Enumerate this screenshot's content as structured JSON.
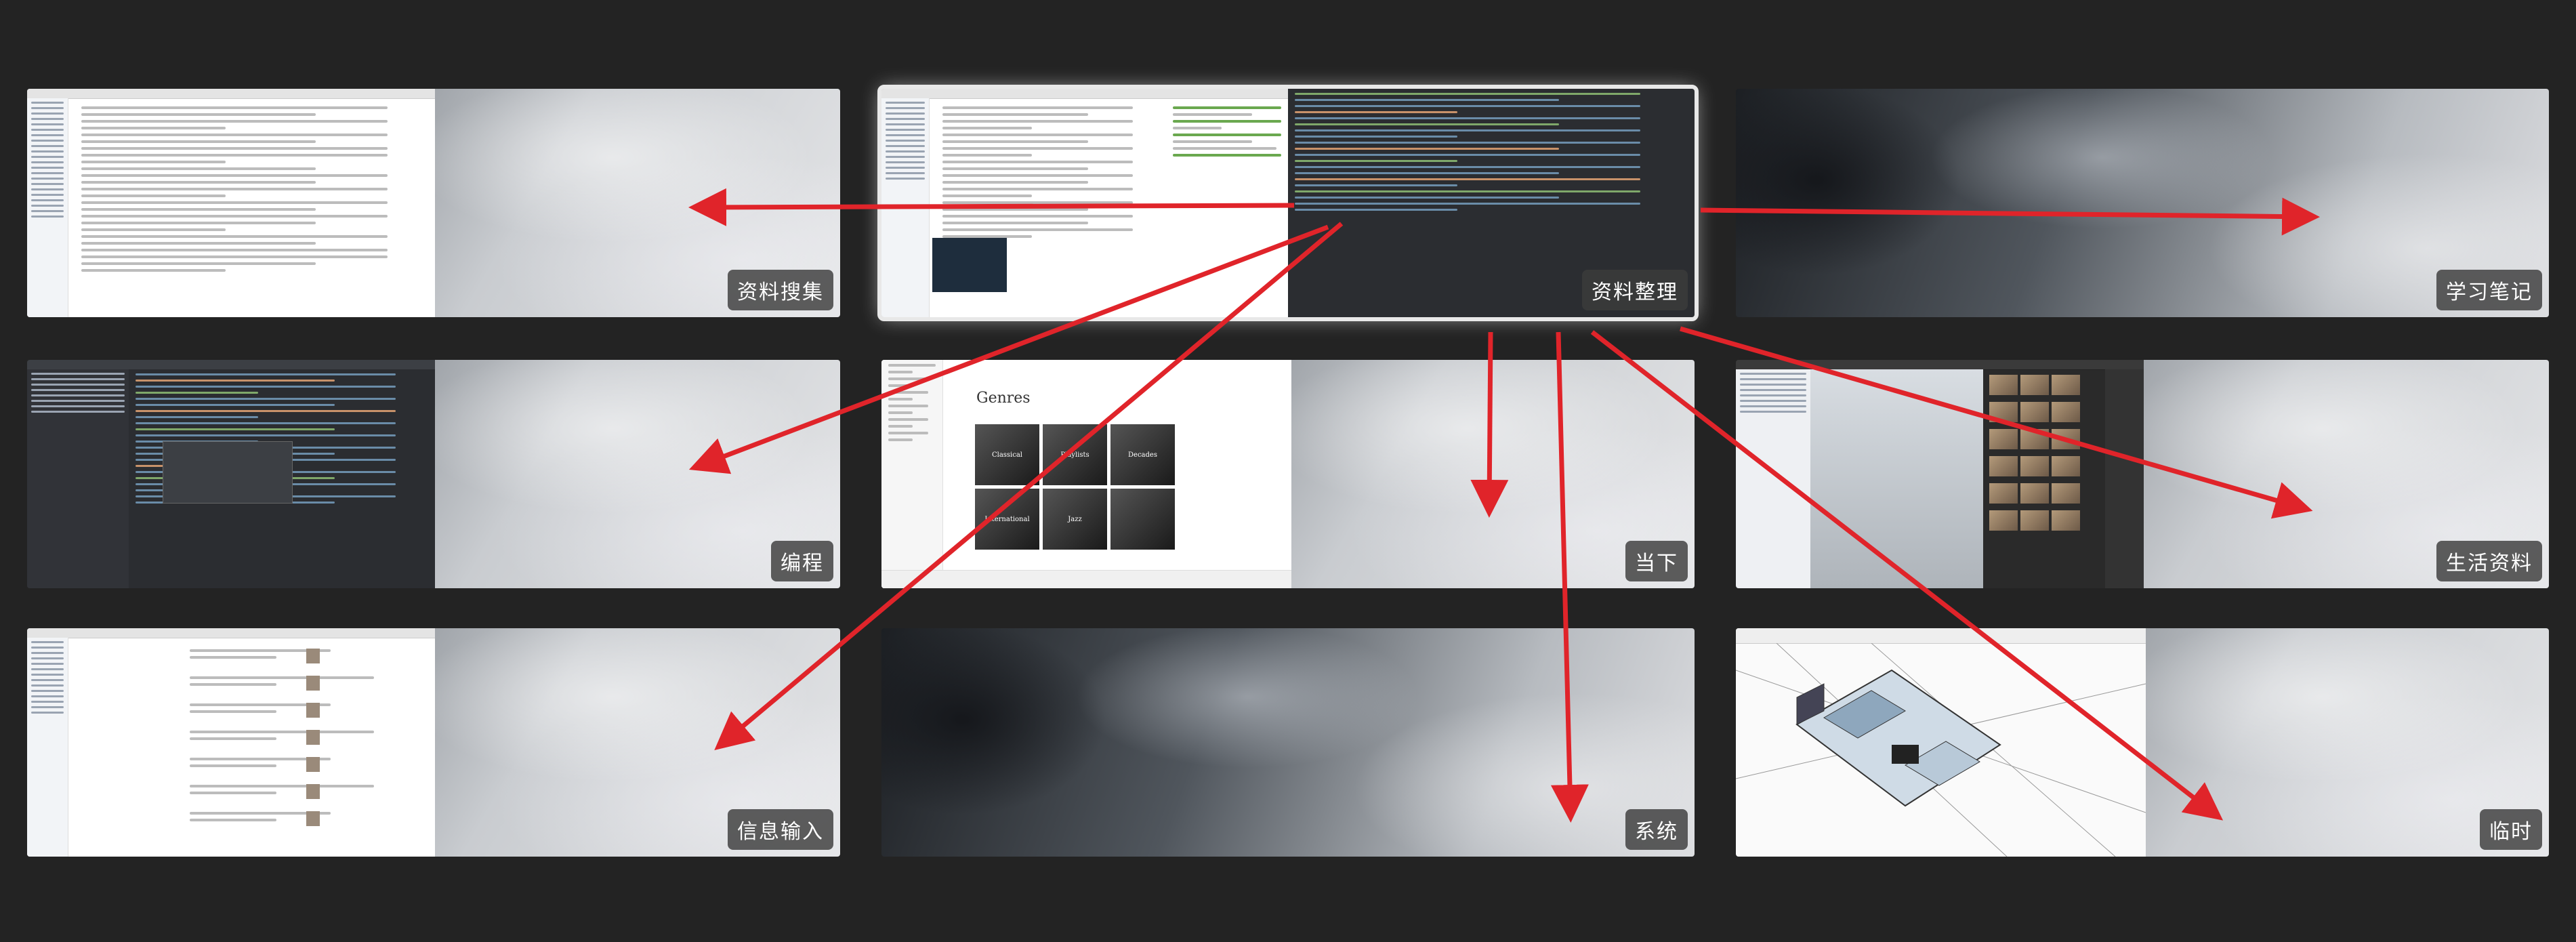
{
  "spaces": [
    {
      "label": "资料搜集"
    },
    {
      "label": "资料整理"
    },
    {
      "label": "学习笔记"
    },
    {
      "label": "编程"
    },
    {
      "label": "当下"
    },
    {
      "label": "生活资料"
    },
    {
      "label": "信息输入"
    },
    {
      "label": "系统"
    },
    {
      "label": "临时"
    }
  ],
  "genres_window": {
    "title": "Genres",
    "tiles": [
      "Classical",
      "Playlists",
      "Decades",
      "International",
      "Jazz",
      ""
    ]
  },
  "colors": {
    "arrow": "#e0242a",
    "background": "#232323",
    "label_bg": "#3c3c3c"
  }
}
